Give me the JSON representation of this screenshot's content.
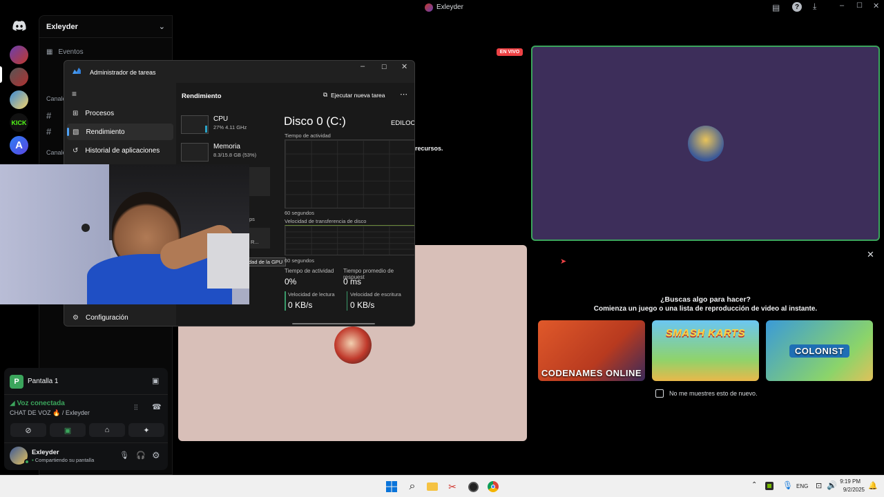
{
  "window_title": "Exleyder",
  "server_name": "Exleyder",
  "sidebar": {
    "events_label": "Eventos",
    "category_1": "Canale",
    "category_2": "Canale"
  },
  "stage": {
    "live_badge": "EN VIVO",
    "partial_text": "recursos."
  },
  "activity": {
    "title": "¿Buscas algo para hacer?",
    "subtitle": "Comienza un juego o una lista de reproducción de video al instante.",
    "games": [
      "CODENAMES ONLINE",
      "SMASH KARTS",
      "COLONIST"
    ],
    "dont_show_label": "No me muestres esto de nuevo."
  },
  "voice_panel": {
    "stream_name": "Pantalla 1",
    "status": "Voz conectada",
    "channel": "CHAT DE VOZ 🔥 / Exleyder",
    "username": "Exleyder",
    "user_status": "Compartiendo su pantalla"
  },
  "task_manager": {
    "title": "Administrador de tareas",
    "section_title": "Rendimiento",
    "run_task": "Ejecutar nueva tarea",
    "nav": [
      "Procesos",
      "Rendimiento",
      "Historial de aplicaciones"
    ],
    "settings": "Configuración",
    "cpu": {
      "name": "CPU",
      "detail": "27% 4.11 GHz"
    },
    "memory": {
      "name": "Memoria",
      "detail": "8.3/15.8 GB (53%)"
    },
    "partial_ps": "ps",
    "partial_r": "R...",
    "gpu_tooltip": "dad de la GPU",
    "disk_title": "Disco 0 (C:)",
    "disk_model": "EDILOC",
    "activity_time": "Tiempo de actividad",
    "seconds_1": "60 segundos",
    "transfer_speed": "Velocidad de transferencia de disco",
    "seconds_2": "60 segundos",
    "stat_active_label": "Tiempo de actividad",
    "stat_active_value": "0%",
    "stat_resp_label": "Tiempo promedio de respuest",
    "stat_resp_value": "0 ms",
    "read_label": "Velocidad de lectura",
    "read_value": "0 KB/s",
    "write_label": "Velocidad de escritura",
    "write_value": "0 KB/s"
  },
  "taskbar": {
    "lang": "ENG",
    "time": "9:19 PM",
    "date": "9/2/2025"
  },
  "colors": {
    "accent_green": "#3ba55c",
    "live_red": "#ed4245",
    "discord_blurple": "#5865f2"
  }
}
